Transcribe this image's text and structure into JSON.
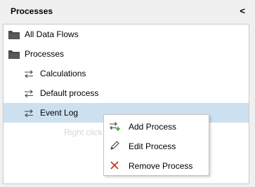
{
  "header": {
    "title": "Processes",
    "collapse_glyph": "<"
  },
  "tree": {
    "items": [
      {
        "label": "All Data Flows",
        "icon": "folder-icon"
      },
      {
        "label": "Processes",
        "icon": "folder-icon"
      },
      {
        "label": "Calculations",
        "icon": "process-arrows-icon"
      },
      {
        "label": "Default process",
        "icon": "process-arrows-icon"
      },
      {
        "label": "Event Log",
        "icon": "process-arrows-icon",
        "selected": true
      }
    ],
    "hint": "Right click"
  },
  "context_menu": {
    "items": [
      {
        "label": "Add Process",
        "icon": "add-process-icon"
      },
      {
        "label": "Edit Process",
        "icon": "pencil-icon"
      },
      {
        "label": "Remove Process",
        "icon": "remove-x-icon"
      }
    ]
  },
  "colors": {
    "selected_row": "#cde0f0",
    "remove_icon": "#c0392b",
    "add_icon_plus": "#2e9d3a"
  }
}
